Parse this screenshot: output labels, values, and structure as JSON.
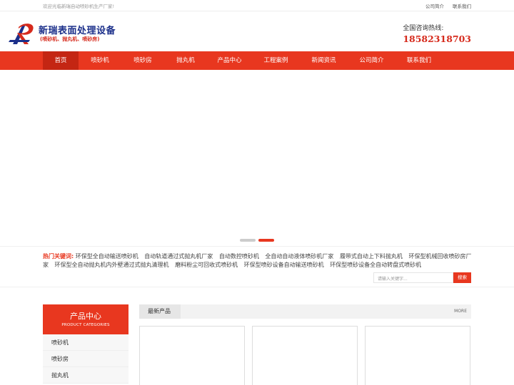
{
  "topbar": {
    "welcome": "欢迎光临新瑞自动喷砂机生产厂家!",
    "links": [
      "公司简介",
      "联系我们"
    ]
  },
  "logo": {
    "title": "新瑞表面处理设备",
    "subtitle": "(喷砂机、抛丸机、喷砂房)"
  },
  "hotline": {
    "label": "全国咨询热线:",
    "phone": "18582318703"
  },
  "nav": {
    "items": [
      "首页",
      "喷砂机",
      "喷砂房",
      "抛丸机",
      "产品中心",
      "工程案例",
      "新闻资讯",
      "公司简介",
      "联系我们"
    ],
    "active_index": 0
  },
  "banner": {
    "slide_count": 2,
    "active_slide": 1
  },
  "hotwords": {
    "label": "热门关键词:",
    "keywords": [
      "环保型全自动输送喷砂机",
      "自动轨道通过式抛丸机厂家",
      "自动数控喷砂机",
      "全自动自动液体喷砂机厂家",
      "履带式自动上下料抛丸机",
      "环保型机械回收喷砂房厂家",
      "环保型全自动抛丸机内外壁通过式抛丸清理机",
      "磨料粉尘可回收式喷砂机",
      "环保型喷砂设备自动输送喷砂机",
      "环保型喷砂设备全自动转盘式喷砂机"
    ]
  },
  "search": {
    "placeholder": "请输入关键字...",
    "button": "搜索"
  },
  "sidebar": {
    "title": "产品中心",
    "subtitle": "PRODUCT CATEGORIES",
    "items": [
      "喷砂机",
      "喷砂房",
      "抛丸机"
    ]
  },
  "products": {
    "tab": "最新产品",
    "more": "MORE"
  },
  "colors": {
    "accent": "#e8371f",
    "nav_active": "#c42613",
    "brand_blue": "#1b2f8a"
  }
}
